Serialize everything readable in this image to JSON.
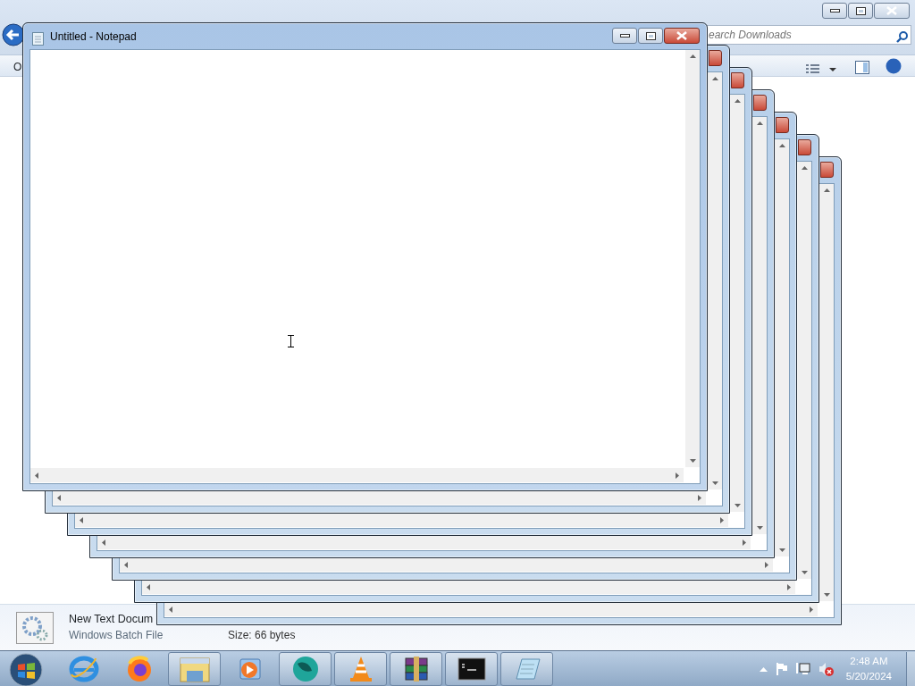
{
  "explorer": {
    "toolbar_label": "O",
    "search": {
      "placeholder": "earch Downloads"
    },
    "details": {
      "name": "New Text Docum",
      "type": "Windows Batch File",
      "size": "Size: 66 bytes"
    }
  },
  "notepad_windows": [
    {
      "kind": "back"
    },
    {
      "kind": "back"
    },
    {
      "kind": "back"
    },
    {
      "kind": "back"
    },
    {
      "kind": "back"
    },
    {
      "kind": "back"
    },
    {
      "kind": "front",
      "title": "Untitled - Notepad"
    }
  ],
  "taskbar": {
    "items": [
      {
        "kind": "ie",
        "running": false
      },
      {
        "kind": "firefox",
        "running": false
      },
      {
        "kind": "folder",
        "running": true
      },
      {
        "kind": "player",
        "running": false
      },
      {
        "kind": "globe",
        "running": true
      },
      {
        "kind": "cone",
        "running": true
      },
      {
        "kind": "archive",
        "running": true
      },
      {
        "kind": "console",
        "running": true
      },
      {
        "kind": "notepad",
        "running": true
      }
    ],
    "clock": {
      "time": "2:48 AM",
      "date": "5/20/2024"
    }
  }
}
